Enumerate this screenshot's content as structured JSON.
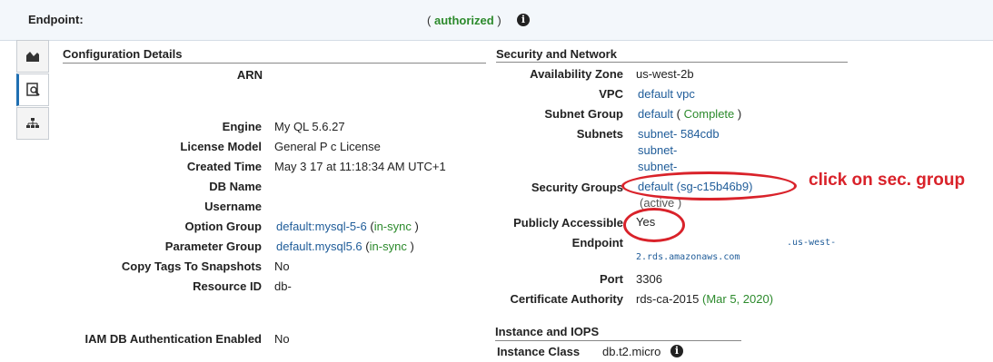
{
  "header": {
    "endpoint_label": "Endpoint:",
    "status_open": "(",
    "status_text": "authorized",
    "status_close": ")"
  },
  "config": {
    "title": "Configuration Details",
    "arn_label": "ARN",
    "engine_label": "Engine",
    "engine_value": "My QL 5.6.27",
    "license_label": "License Model",
    "license_value": "General P   c License",
    "created_label": "Created Time",
    "created_value": "May 3   17 at 11:18:34 AM UTC+1",
    "dbname_label": "DB Name",
    "username_label": "Username",
    "option_label": "Option Group",
    "option_link": "default:mysql-5-6",
    "option_status": "in-sync",
    "param_label": "Parameter Group",
    "param_link": "default.mysql5.6",
    "param_status": "in-sync",
    "copytags_label": "Copy Tags To Snapshots",
    "copytags_value": "No",
    "resource_label": "Resource ID",
    "resource_value": "db-",
    "iam_label": "IAM DB Authentication Enabled",
    "iam_value": "No"
  },
  "security": {
    "title": "Security and Network",
    "az_label": "Availability Zone",
    "az_value": "us-west-2b",
    "vpc_label": "VPC",
    "vpc_link": "default vpc",
    "subnetgroup_label": "Subnet Group",
    "subnetgroup_link": "default",
    "subnetgroup_status": "Complete",
    "subnets_label": "Subnets",
    "subnet_1": "subnet-   584cdb",
    "subnet_2": "subnet-",
    "subnet_3": "subnet-",
    "secgroups_label": "Security Groups",
    "secgroup_link": "default (sg-c15b46b9)",
    "secgroup_status": "(active )",
    "public_label": "Publicly Accessible",
    "public_value": "Yes",
    "endpoint_label": "Endpoint",
    "endpoint_part1": ".us-west-",
    "endpoint_part2": "2.rds.amazonaws.com",
    "port_label": "Port",
    "port_value": "3306",
    "cert_label": "Certificate Authority",
    "cert_value": "rds-ca-2015",
    "cert_date": "(Mar 5, 2020)"
  },
  "instance": {
    "title": "Instance and IOPS",
    "class_label": "Instance Class",
    "class_value": "db.t2.micro"
  },
  "annotation": {
    "text": "click on sec. group"
  },
  "colors": {
    "link": "#1f5c99",
    "status_green": "#2c8a2c",
    "annotation_red": "#d9222a",
    "active_tab": "#1f6fb2"
  },
  "icons": [
    "monitoring-icon",
    "details-icon",
    "topology-icon",
    "info-icon"
  ]
}
